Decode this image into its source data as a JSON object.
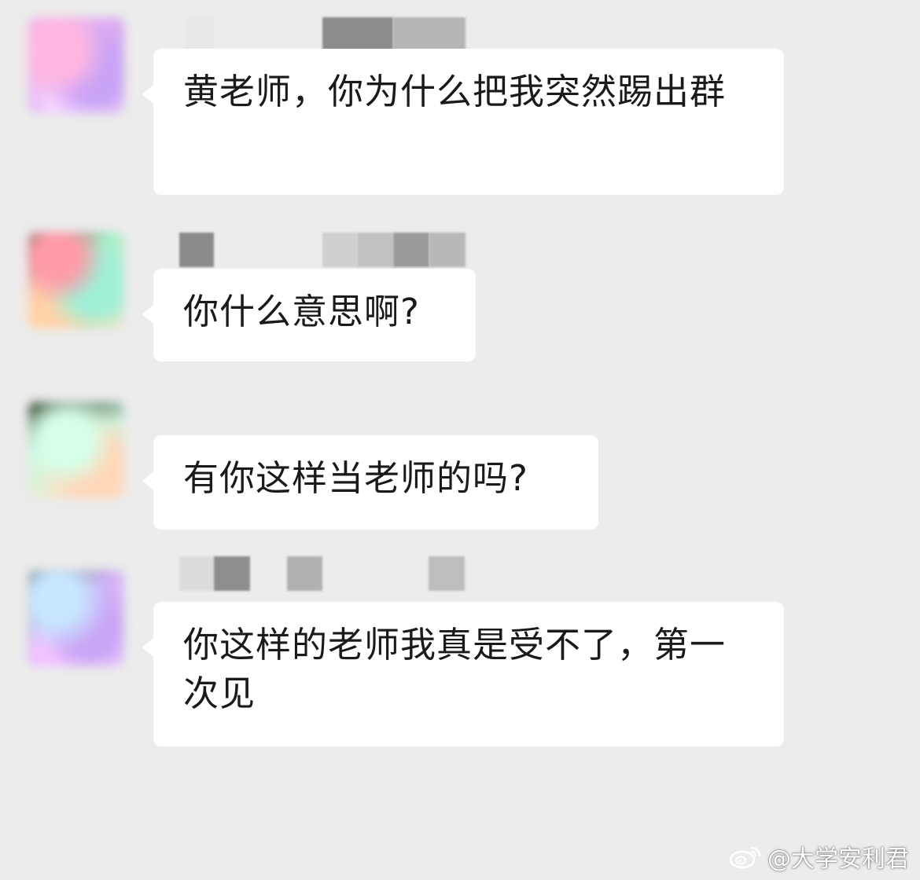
{
  "messages": [
    {
      "text": "黄老师，你为什么把我突然踢出群"
    },
    {
      "text": "你什么意思啊?"
    },
    {
      "text": "有你这样当老师的吗?"
    },
    {
      "text": "你这样的老师我真是受不了，第一次见"
    }
  ],
  "watermark": {
    "text": "@大学安利君",
    "icon": "weibo-icon"
  },
  "colors": {
    "background": "#ececec",
    "bubble": "#ffffff",
    "text": "#1a1a1a"
  }
}
